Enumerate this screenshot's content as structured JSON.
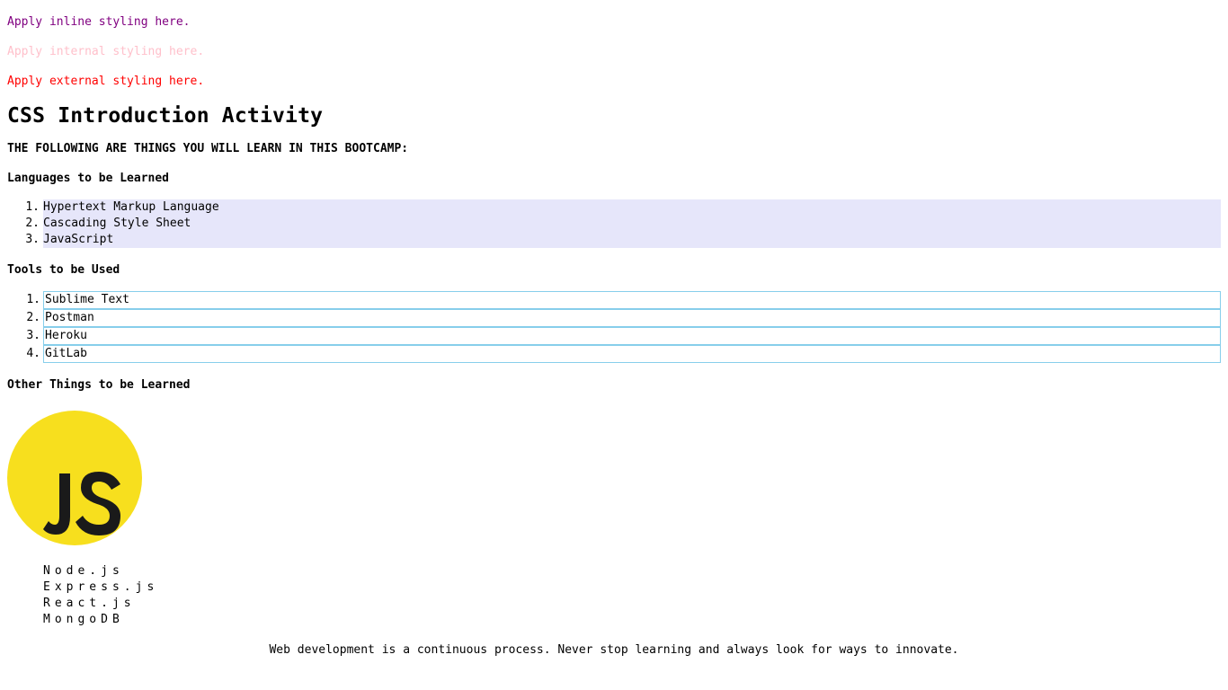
{
  "notes": {
    "inline": "Apply inline styling here.",
    "internal": "Apply internal styling here.",
    "external": "Apply external styling here."
  },
  "title": "CSS Introduction Activity",
  "subtitle": "THE FOLLOWING ARE THINGS YOU WILL LEARN IN THIS BOOTCAMP:",
  "languages": {
    "heading": "Languages to be Learned",
    "items": [
      {
        "num": "1.",
        "label": "Hypertext Markup Language"
      },
      {
        "num": "2.",
        "label": "Cascading Style Sheet"
      },
      {
        "num": "3.",
        "label": "JavaScript"
      }
    ]
  },
  "tools": {
    "heading": "Tools to be Used",
    "items": [
      {
        "num": "1.",
        "label": "Sublime Text"
      },
      {
        "num": "2.",
        "label": "Postman"
      },
      {
        "num": "3.",
        "label": "Heroku"
      },
      {
        "num": "4.",
        "label": "GitLab"
      }
    ]
  },
  "other": {
    "heading": "Other Things to be Learned",
    "logo": {
      "icon": "javascript-logo-icon",
      "text": "JS",
      "bg_color": "#f7df1e"
    },
    "items": [
      "Node.js",
      "Express.js",
      "React.js",
      "MongoDB"
    ]
  },
  "footer": "Web development is a continuous process. Never stop learning and always look for ways to innovate.",
  "colors": {
    "inline": "#800080",
    "internal": "#ffc0cb",
    "external": "#ff0000",
    "lang_bg": "#e6e6fa",
    "tool_border": "#87ceeb"
  }
}
